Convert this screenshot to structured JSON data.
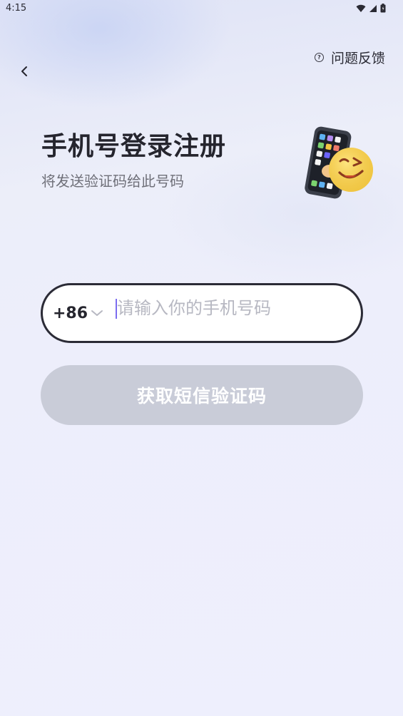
{
  "status_bar": {
    "time": "4:15",
    "icons": [
      "wifi-icon",
      "signal-icon",
      "battery-icon"
    ]
  },
  "header": {
    "back_icon": "chevron-left-icon",
    "feedback_icon": "help-circle-icon",
    "feedback_label": "问题反馈"
  },
  "main": {
    "title": "手机号登录注册",
    "subtitle": "将发送验证码给此号码",
    "illustration": "phone-with-smiley-illustration",
    "phone_input": {
      "country_code": "+86",
      "value": "",
      "placeholder": "请输入你的手机号码"
    },
    "get_code_button": {
      "label": "获取短信验证码",
      "enabled": false
    }
  },
  "colors": {
    "background": "#eeeffd",
    "title_text": "#25252e",
    "subtitle_text": "#6f7079",
    "input_border": "#2b2b36",
    "placeholder_text": "#b7b8c2",
    "caret": "#7b6cf0",
    "button_disabled_bg": "#c9ccd8",
    "button_text": "#ffffff"
  }
}
